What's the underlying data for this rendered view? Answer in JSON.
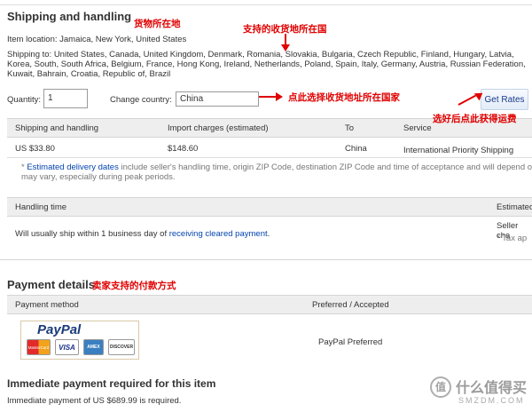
{
  "shipping": {
    "title": "Shipping and handling",
    "item_location": "Item location: Jamaica, New York, United States",
    "ships_to_line1": "Shipping to: United States, Canada, United Kingdom, Denmark, Romania, Slovakia, Bulgaria, Czech Republic, Finland, Hungary, Latvia,",
    "ships_to_line2": "Korea, South, South Africa, Belgium, France, Hong Kong, Ireland, Netherlands, Poland, Spain, Italy, Germany, Austria, Russian Federation,",
    "ships_to_line3": "Kuwait, Bahrain, Croatia, Republic of, Brazil",
    "quantity_label": "Quantity:",
    "quantity_value": "1",
    "country_label": "Change country:",
    "country_value": "China",
    "get_rates": "Get Rates",
    "table_headers": [
      "Shipping and handling",
      "Import charges (estimated)",
      "To",
      "Service"
    ],
    "table_row": [
      "US $33.80",
      "$148.60",
      "China",
      "International Priority Shipping"
    ],
    "note_star": "*",
    "note_link": "Estimated delivery dates",
    "note_rest": " include seller's handling time, origin ZIP Code, destination ZIP Code and time of acceptance and will depend on",
    "note_line2": "may vary, especially during peak periods.",
    "handling_header": "Handling time",
    "handling_header_right": "Estimated",
    "handling_text_pre": "Will usually ship within 1 business day of ",
    "handling_link": "receiving cleared payment",
    "handling_text_post": ".",
    "handling_right1": "Seller cha",
    "handling_right2": "* Tax ap"
  },
  "payment": {
    "title": "Payment details",
    "headers": [
      "Payment method",
      "Preferred / Accepted"
    ],
    "paypal_logo": "PayPal",
    "cards": [
      "MasterCard",
      "VISA",
      "AMEX",
      "DISCOVER"
    ],
    "paypal_status": "PayPal Preferred",
    "immediate_title": "Immediate payment required for this item",
    "immediate_text": "Immediate payment of US $689.99 is required."
  },
  "annotations": {
    "a1": "货物所在地",
    "a2": "支持的收货地所在国",
    "a3": "点此选择收货地址所在国家",
    "a4": "选好后点此获得运费",
    "a5": "卖家支持的付款方式"
  },
  "watermark": {
    "badge": "值",
    "text": "什么值得买",
    "sub": "SMZDM.COM"
  },
  "colors": {
    "annotation": "#e00000",
    "link": "#0645ad",
    "header_bg": "#eeeeee"
  }
}
